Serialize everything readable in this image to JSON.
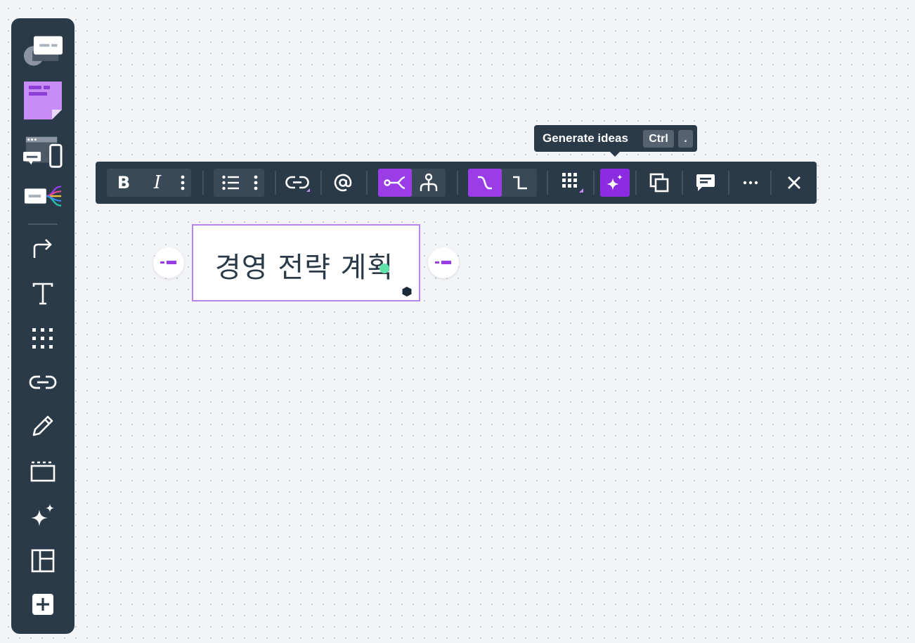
{
  "sidebar": {
    "tools": [
      {
        "name": "templates",
        "icon": "templates-icon"
      },
      {
        "name": "sticky-note",
        "icon": "sticky-note-icon"
      },
      {
        "name": "wireframes",
        "icon": "wireframe-devices-icon"
      },
      {
        "name": "mind-map",
        "icon": "mind-map-icon"
      },
      {
        "name": "connection-line",
        "icon": "arrow-connector-icon"
      },
      {
        "name": "text",
        "icon": "text-icon"
      },
      {
        "name": "apps",
        "icon": "grid-apps-icon"
      },
      {
        "name": "link",
        "icon": "link-icon"
      },
      {
        "name": "pen",
        "icon": "pen-icon"
      },
      {
        "name": "frame",
        "icon": "frame-icon"
      },
      {
        "name": "ai",
        "icon": "sparkle-icon"
      },
      {
        "name": "layout",
        "icon": "layout-icon"
      },
      {
        "name": "more-tools",
        "icon": "plus-box-icon"
      }
    ]
  },
  "format_toolbar": {
    "bold_label": "B",
    "italic_label": "I",
    "icons": [
      "bold-icon",
      "italic-icon",
      "more-vertical-icon",
      "bullet-list-icon",
      "link-icon",
      "mention-icon",
      "mindmap-layout-icon",
      "org-chart-icon",
      "curved-branch-icon",
      "elbow-branch-icon",
      "color-grid-icon",
      "sparkle-icon",
      "duplicate-icon",
      "comment-icon",
      "more-horizontal-icon",
      "close-icon"
    ]
  },
  "tooltip": {
    "label": "Generate ideas",
    "keys": [
      "Ctrl",
      "."
    ]
  },
  "node": {
    "text": "경영 전략 계획"
  },
  "colors": {
    "toolbar_bg": "#2b3a48",
    "accent": "#9a3de7",
    "accent_strong": "#8b2be2",
    "node_border": "#b784ee",
    "cursor": "#5fe3a8"
  }
}
